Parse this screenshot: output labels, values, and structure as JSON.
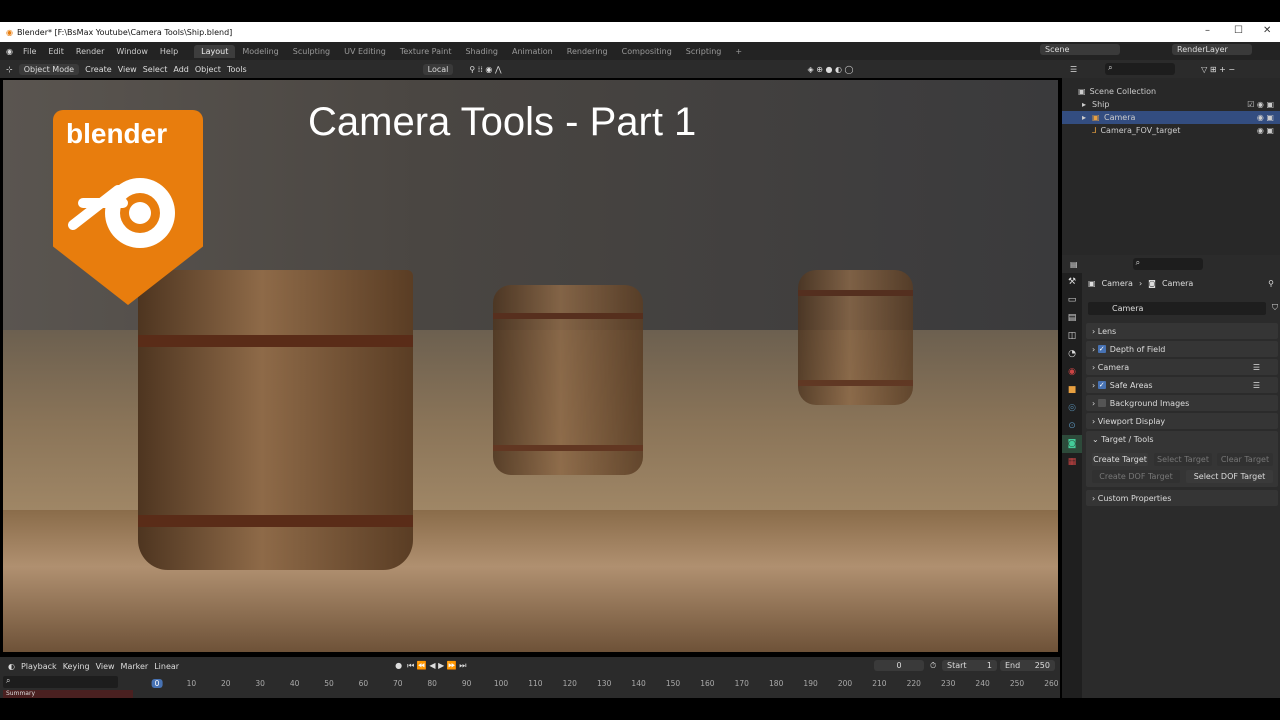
{
  "window": {
    "title": "Blender* [F:\\BsMax Youtube\\Camera Tools\\Ship.blend]",
    "minimize": "–",
    "maximize": "☐",
    "close": "✕"
  },
  "menu": [
    "File",
    "Edit",
    "Render",
    "Window",
    "Help"
  ],
  "workspaces": [
    "Layout",
    "Modeling",
    "Sculpting",
    "UV Editing",
    "Texture Paint",
    "Shading",
    "Animation",
    "Rendering",
    "Compositing",
    "Scripting",
    "+"
  ],
  "scene": "Scene",
  "render_layer": "RenderLayer",
  "header": {
    "mode": "Object Mode",
    "items": [
      "Create",
      "View",
      "Select",
      "Add",
      "Object",
      "Tools"
    ],
    "orientation": "Local"
  },
  "viewport": {
    "overlay_title": "Camera Tools - Part 1",
    "logo_text": "blender"
  },
  "outliner": {
    "items": [
      {
        "label": "Scene Collection"
      },
      {
        "label": "Ship"
      },
      {
        "label": "Camera"
      },
      {
        "label": "Camera_FOV_target"
      }
    ]
  },
  "properties": {
    "breadcrumb": [
      "Camera",
      "Camera"
    ],
    "data_name": "Camera",
    "panels": [
      {
        "label": "Lens",
        "check": null
      },
      {
        "label": "Depth of Field",
        "check": true
      },
      {
        "label": "Camera",
        "check": null
      },
      {
        "label": "Safe Areas",
        "check": true
      },
      {
        "label": "Background Images",
        "check": false
      },
      {
        "label": "Viewport Display",
        "check": null
      },
      {
        "label": "Target / Tools",
        "check": null
      }
    ],
    "buttons": {
      "create_target": "Create Target",
      "select_target": "Select Target",
      "clear_target": "Clear Target",
      "create_dof": "Create DOF Target",
      "select_dof": "Select DOF Target"
    },
    "custom": "Custom Properties"
  },
  "timeline": {
    "playback": "Playback",
    "keying": "Keying",
    "view": "View",
    "marker": "Marker",
    "interp": "Linear",
    "current": "0",
    "start_label": "Start",
    "start": "1",
    "end_label": "End",
    "end": "250",
    "summary": "Summary",
    "ticks": [
      "0",
      "10",
      "20",
      "30",
      "40",
      "50",
      "60",
      "70",
      "80",
      "90",
      "100",
      "110",
      "120",
      "130",
      "140",
      "150",
      "160",
      "170",
      "180",
      "190",
      "200",
      "210",
      "220",
      "230",
      "240",
      "250",
      "260"
    ]
  }
}
